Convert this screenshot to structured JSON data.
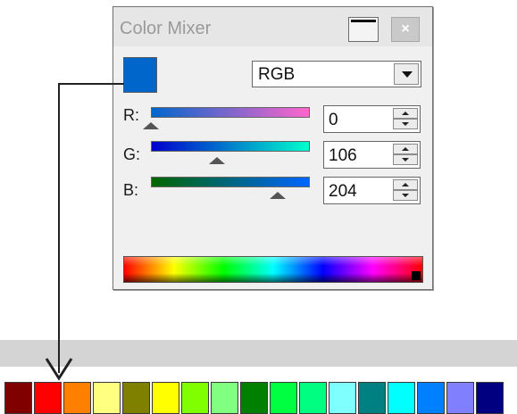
{
  "window": {
    "title": "Color Mixer",
    "close_glyph": "×",
    "maximize_icon": "maximize-icon",
    "close_icon": "close-icon"
  },
  "current_color": "#0066CC",
  "mode": {
    "selected": "RGB",
    "dropdown_icon": "chevron-down-icon"
  },
  "channels": [
    {
      "label": "R:",
      "value": "0",
      "level": 0.0,
      "gradient_from": "#0066CC",
      "gradient_to": "#FF66CC"
    },
    {
      "label": "G:",
      "value": "106",
      "level": 0.4157,
      "gradient_from": "#0000CC",
      "gradient_to": "#00FFCC"
    },
    {
      "label": "B:",
      "value": "204",
      "level": 0.8,
      "gradient_from": "#006600",
      "gradient_to": "#0066FF"
    }
  ],
  "palette": [
    "#800000",
    "#FF0000",
    "#FF8000",
    "#FFFF80",
    "#808000",
    "#FFFF00",
    "#80FF00",
    "#80FF80",
    "#008000",
    "#00FF40",
    "#00FF80",
    "#80FFFF",
    "#008080",
    "#00FFFF",
    "#0080FF",
    "#8080FF",
    "#000080"
  ],
  "pointer": {
    "target_swatch_index": 1
  }
}
